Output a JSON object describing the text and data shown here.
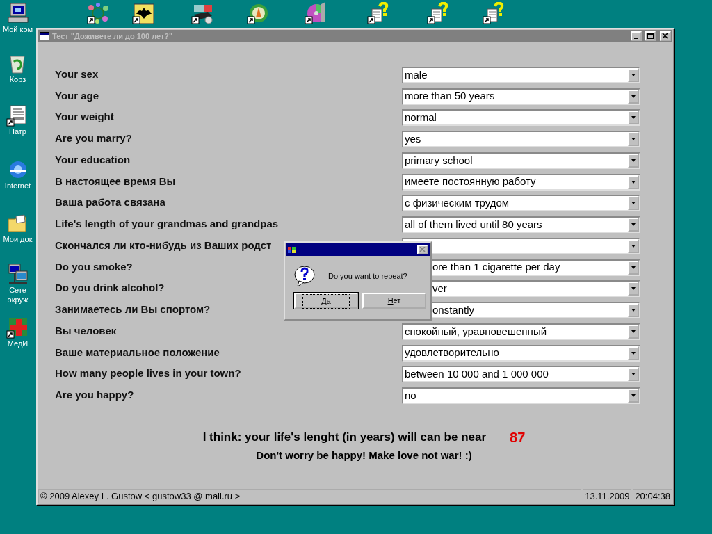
{
  "desktop_icons": [
    {
      "kind": "computer",
      "lines": [
        "Мой ком"
      ]
    },
    {
      "kind": "recycle",
      "lines": [
        "Корз"
      ]
    },
    {
      "kind": "document",
      "lines": [
        "Патр"
      ]
    },
    {
      "kind": "browser",
      "lines": [
        "Internet"
      ]
    },
    {
      "kind": "folder",
      "lines": [
        "Мои док"
      ]
    },
    {
      "kind": "network",
      "lines": [
        "Сете",
        "окруж"
      ]
    },
    {
      "kind": "medical",
      "lines": [
        "МедИ"
      ]
    }
  ],
  "window": {
    "title": "Тест \"Доживете ли до 100 лет?\"",
    "active": false,
    "form": [
      {
        "label": "Your sex",
        "value": "male"
      },
      {
        "label": "Your age",
        "value": "more than 50 years"
      },
      {
        "label": "Your weight",
        "value": "normal"
      },
      {
        "label": "Are you marry?",
        "value": "yes"
      },
      {
        "label": "Your education",
        "value": "primary school"
      },
      {
        "label": "В настоящее время Вы",
        "value": "имеете постоянную работу"
      },
      {
        "label": "Ваша работа связана",
        "value": "с физическим трудом"
      },
      {
        "label": "Life's length of your grandmas and grandpas",
        "value": "all of them lived until 80 years"
      },
      {
        "label": "Скончался ли кто-нибудь из Ваших родст",
        "obscured": true
      },
      {
        "label": "Do you smoke?",
        "value": "ore than 1 cigarette per day",
        "obscured": true
      },
      {
        "label": "Do you drink alcohol?",
        "value": "ver",
        "obscured": true
      },
      {
        "label": "Занимаетесь ли Вы спортом?",
        "value": "onstantly",
        "obscured": true
      },
      {
        "label": "Вы человек",
        "value": "спокойный, уравновешенный"
      },
      {
        "label": "Ваше материальное положение",
        "value": "удовлетворительно"
      },
      {
        "label": "How many people lives in your town?",
        "value": "between 10 000 and 1 000 000"
      },
      {
        "label": "Are you happy?",
        "value": "no"
      }
    ],
    "result": {
      "text": "I think: your life's lenght (in years) will can be near",
      "value": "87",
      "note": "Don't worry be happy! Make love not war! :)"
    },
    "status_bar": [
      "© 2009 Alexey L. Gustow < gustow33 @ mail.ru >",
      "13.11.2009",
      "20:04:38"
    ]
  },
  "dialog": {
    "message": "Do you want to repeat?",
    "buttons": [
      {
        "label": "Да",
        "default": true
      },
      {
        "label": "Нет",
        "default": false
      }
    ]
  }
}
